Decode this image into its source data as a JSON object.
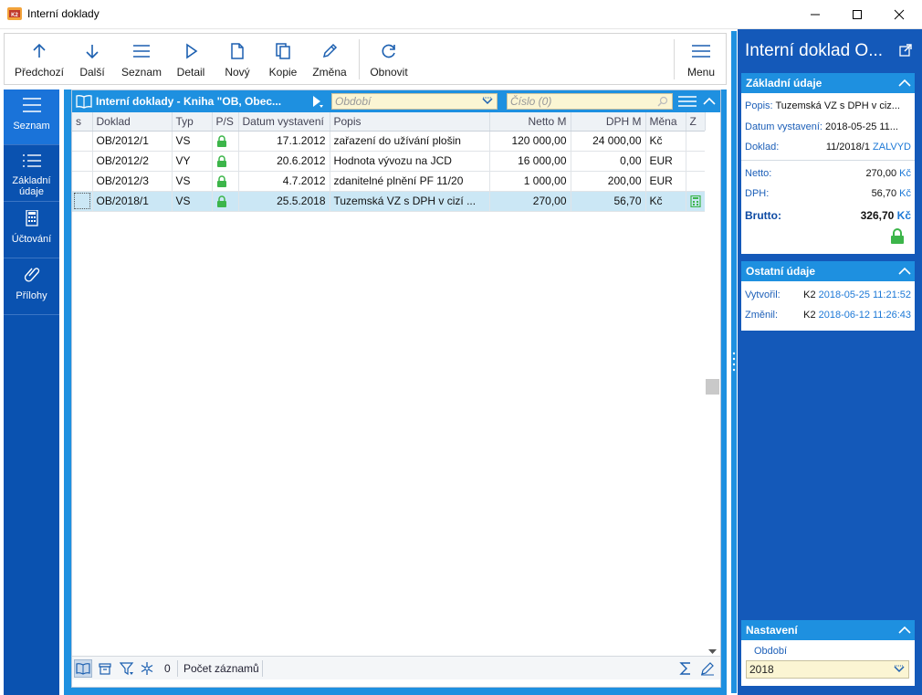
{
  "window": {
    "title": "Interní doklady",
    "icon": "k2-app-icon"
  },
  "toolbar": {
    "buttons": [
      {
        "label": "Předchozí",
        "icon": "arrow-up-icon"
      },
      {
        "label": "Další",
        "icon": "arrow-down-icon"
      },
      {
        "label": "Seznam",
        "icon": "list-icon"
      },
      {
        "label": "Detail",
        "icon": "play-icon"
      },
      {
        "label": "Nový",
        "icon": "new-document-icon"
      },
      {
        "label": "Kopie",
        "icon": "copy-icon"
      },
      {
        "label": "Změna",
        "icon": "pencil-icon"
      },
      {
        "label": "Obnovit",
        "icon": "refresh-icon"
      },
      {
        "label": "Menu",
        "icon": "hamburger-icon"
      }
    ]
  },
  "sidenav": {
    "items": [
      {
        "label": "Seznam",
        "icon": "list-icon",
        "active": true
      },
      {
        "label": "Základní údaje",
        "icon": "lines-icon",
        "active": false
      },
      {
        "label": "Účtování",
        "icon": "calculator-icon",
        "active": false
      },
      {
        "label": "Přílohy",
        "icon": "paperclip-icon",
        "active": false
      }
    ]
  },
  "grid": {
    "title": "Interní doklady - Kniha \"OB, Obec...",
    "period_placeholder": "Období",
    "number_placeholder": "Číslo (0)",
    "columns": [
      "s",
      "Doklad",
      "Typ",
      "P/S",
      "Datum vystavení",
      "Popis",
      "Netto M",
      "DPH M",
      "Měna",
      "Z"
    ],
    "rows": [
      {
        "doklad": "OB/2012/1",
        "typ": "VS",
        "datum": "17.1.2012",
        "popis": "zařazení do užívání plošin",
        "netto": "120 000,00",
        "dph": "24 000,00",
        "mena": "Kč",
        "selected": false
      },
      {
        "doklad": "OB/2012/2",
        "typ": "VY",
        "datum": "20.6.2012",
        "popis": "Hodnota vývozu na JCD",
        "netto": "16 000,00",
        "dph": "0,00",
        "mena": "EUR",
        "selected": false
      },
      {
        "doklad": "OB/2012/3",
        "typ": "VS",
        "datum": "4.7.2012",
        "popis": "zdanitelné plnění PF 11/20",
        "netto": "1 000,00",
        "dph": "200,00",
        "mena": "EUR",
        "selected": false
      },
      {
        "doklad": "OB/2018/1",
        "typ": "VS",
        "datum": "25.5.2018",
        "popis": "Tuzemská VZ s DPH v cizí ...",
        "netto": "270,00",
        "dph": "56,70",
        "mena": "Kč",
        "selected": true
      }
    ],
    "footer": {
      "count": "0",
      "record_count_label": "Počet záznamů"
    }
  },
  "detail": {
    "title": "Interní doklad O...",
    "basic": {
      "header": "Základní údaje",
      "popis_label": "Popis:",
      "popis_value": "Tuzemská VZ s DPH v ciz...",
      "datum_label": "Datum vystavení:",
      "datum_value": "2018-05-25 11...",
      "doklad_label": "Doklad:",
      "doklad_value": "11/2018/1",
      "doklad_status": "ZALVYD",
      "netto_label": "Netto:",
      "netto_value": "270,00",
      "dph_label": "DPH:",
      "dph_value": "56,70",
      "brutto_label": "Brutto:",
      "brutto_value": "326,70",
      "currency": "Kč"
    },
    "other": {
      "header": "Ostatní údaje",
      "created_label": "Vytvořil:",
      "created_user": "K2",
      "created_time": "2018-05-25 11:21:52",
      "changed_label": "Změnil:",
      "changed_user": "K2",
      "changed_time": "2018-06-12 11:26:43"
    },
    "settings": {
      "header": "Nastavení",
      "period_label": "Období",
      "period_value": "2018"
    }
  },
  "colors": {
    "nav_blue": "#0a52b0",
    "accent_blue": "#1e90e0",
    "right_panel": "#1459b9",
    "selected_row": "#cbe7f5",
    "field_yellow": "#fbf5d3",
    "lock_green": "#3cb54a"
  }
}
